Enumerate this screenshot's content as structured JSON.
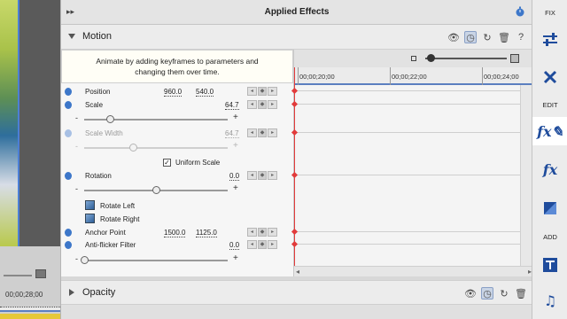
{
  "panel": {
    "title": "Applied Effects",
    "collapse_glyph": "▸▸",
    "header_icon": "stopwatch-icon"
  },
  "motion": {
    "title": "Motion",
    "tooltip_line1": "Animate by adding keyframes to parameters and",
    "tooltip_line2": "changing them over time.",
    "properties": {
      "position": {
        "label": "Position",
        "x": "960.0",
        "y": "540.0"
      },
      "scale": {
        "label": "Scale",
        "value": "64.7",
        "slider_fraction": 0.18
      },
      "scale_width": {
        "label": "Scale Width",
        "value": "64.7",
        "slider_fraction": 0.34
      },
      "uniform_scale": {
        "label": "Uniform Scale",
        "checked": true
      },
      "rotation": {
        "label": "Rotation",
        "value": "0.0",
        "slider_fraction": 0.5
      },
      "rotate_left": {
        "label": "Rotate Left"
      },
      "rotate_right": {
        "label": "Rotate Right"
      },
      "anchor_point": {
        "label": "Anchor Point",
        "x": "1500.0",
        "y": "1125.0"
      },
      "anti_flicker": {
        "label": "Anti-flicker Filter",
        "value": "0.0",
        "slider_fraction": 0.0
      }
    }
  },
  "timeline": {
    "ticks": [
      "00;00;20;00",
      "00;00;22;00",
      "00;00;24;00"
    ]
  },
  "opacity": {
    "title": "Opacity"
  },
  "left_preview": {
    "timecode": "00;00;28;00"
  },
  "sidebar": {
    "fix_label": "FIX",
    "edit_label": "EDIT",
    "add_label": "ADD"
  },
  "slider_glyphs": {
    "minus": "-",
    "plus": "+"
  },
  "colors": {
    "keyframe": "#e23b3b",
    "accent_blue": "#3d77c9",
    "playhead": "#e23b3b"
  }
}
